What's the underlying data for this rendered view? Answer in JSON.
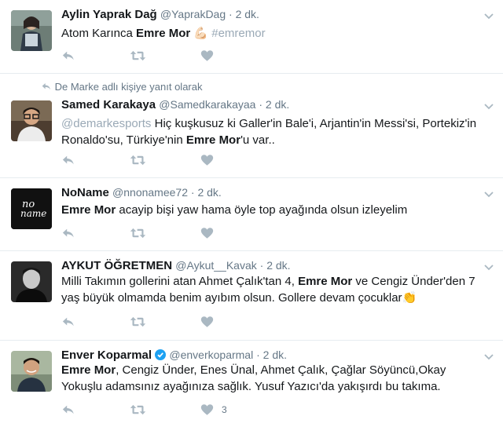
{
  "colors": {
    "border": "#e6ecf0",
    "meta": "#657786",
    "action": "#aab8c2",
    "link": "#1da1f2",
    "verified": "#1da1f2"
  },
  "tweets": [
    {
      "name": "Aylin Yaprak Dağ",
      "handle": "@YaprakDag",
      "sep": " · ",
      "time": "2 dk.",
      "text_a": "Atom Karınca ",
      "text_b": "Emre Mor",
      "text_c": " 💪🏻 ",
      "text_d": "#emremor",
      "avatar_icon": "woman-photo"
    },
    {
      "reply_context": "De Marke adlı kişiye yanıt olarak",
      "name": "Samed Karakaya",
      "handle": "@Samedkarakayaa",
      "sep": " · ",
      "time": "2 dk.",
      "line1_a": "@demarkesports",
      "line1_b": "  Hiç kuşkusuz ki Galler'in Bale'i, Arjantin'in Messi'si, Portekiz'in",
      "line2_a": "Ronaldo'su, Türkiye'nin ",
      "line2_b": "Emre Mor",
      "line2_c": "'u var..",
      "avatar_icon": "man-glasses-photo"
    },
    {
      "name": "NoName",
      "handle": "@nnonamee72",
      "sep": " · ",
      "time": "2 dk.",
      "text_a": "Emre Mor",
      "text_b": " acayip bişi yaw hama öyle top ayağında olsun izleyelim",
      "avatar_text_1": "no",
      "avatar_text_2": "name"
    },
    {
      "name": "AYKUT ÖĞRETMEN",
      "handle": "@Aykut__Kavak",
      "sep": " · ",
      "time": "2 dk.",
      "line1_a": "Milli Takımın gollerini atan Ahmet Çalık'tan 4, ",
      "line1_b": "Emre Mor",
      "line1_c": " ve Cengiz Ünder'den 7",
      "line2_a": "yaş büyük olmamda benim ayıbım olsun. Gollere devam çocuklar",
      "line2_emoji": "👏",
      "avatar_icon": "man-portrait-photo"
    },
    {
      "name": "Enver Koparmal",
      "handle": "@enverkoparmal",
      "sep": " · ",
      "time": "2 dk.",
      "line1_a": "Emre Mor",
      "line1_b": ", Cengiz Ünder, Enes Ünal, Ahmet Çalık, Çağlar Söyüncü,Okay",
      "line2_a": "Yokuşlu adamsınız ayağınıza sağlık. Yusuf Yazıcı'da yakışırdı bu takıma.",
      "like_count": "3",
      "avatar_icon": "smiling-man-photo"
    }
  ]
}
